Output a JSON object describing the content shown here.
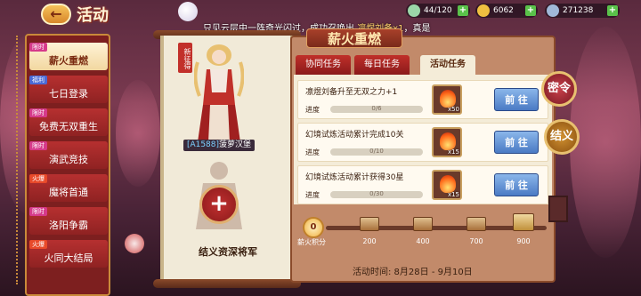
{
  "header": {
    "back_label": "←",
    "title": "活动",
    "marquee_prefix": "只见云层中一阵奇光闪过，成功召唤出 ",
    "marquee_hero": "凛煜刘备x1",
    "marquee_suffix": "，真是"
  },
  "resources": [
    {
      "icon": "jade-icon",
      "value": "44/120",
      "color": "#9bd6a8"
    },
    {
      "icon": "gold-ingot-icon",
      "value": "6062",
      "color": "#f0c040"
    },
    {
      "icon": "silver-coin-icon",
      "value": "271238",
      "color": "#a0b8d8"
    }
  ],
  "sidebar": {
    "items": [
      {
        "tag": "限时",
        "label": "薪火重燃",
        "active": true
      },
      {
        "tag": "福利",
        "label": "七日登录",
        "active": false
      },
      {
        "tag": "限时",
        "label": "免费无双重生",
        "active": false
      },
      {
        "tag": "限时",
        "label": "演武竞技",
        "active": false
      },
      {
        "tag": "火爆",
        "label": "魔将首通",
        "active": false
      },
      {
        "tag": "限时",
        "label": "洛阳争霸",
        "active": false
      },
      {
        "tag": "火爆",
        "label": "火同大结局",
        "active": false
      }
    ]
  },
  "hero": {
    "badge": "新征得",
    "id": "[A1588]",
    "name": "菠萝汉堡"
  },
  "recruit": {
    "button_symbol": "+",
    "label": "结义资深将军"
  },
  "panel": {
    "title": "薪火重燃",
    "tabs": [
      "协同任务",
      "每日任务",
      "活动任务"
    ],
    "active_tab": 2,
    "progress_label": "进度",
    "go_label": "前 往"
  },
  "tasks": [
    {
      "title": "凛煜刘备升至无双之力+1",
      "progress_text": "0/6",
      "progress": 0,
      "reward": "flame-icon",
      "reward_count": "x50"
    },
    {
      "title": "幻境试炼活动累计完成10关",
      "progress_text": "0/10",
      "progress": 0,
      "reward": "flame-icon",
      "reward_count": "x15"
    },
    {
      "title": "幻境试炼活动累计获得30星",
      "progress_text": "0/30",
      "progress": 0,
      "reward": "flame-icon",
      "reward_count": "x15"
    }
  ],
  "milestones": {
    "score": "0",
    "score_label": "薪火积分",
    "values": [
      "200",
      "400",
      "700",
      "900"
    ]
  },
  "event_time": "活动时间:  8月28日 - 9月10日",
  "side_buttons": {
    "secret": "密令",
    "sworn": "结义"
  },
  "colors": {
    "accent_red": "#b63030",
    "gold": "#c98a3a",
    "button_blue": "#4a7ac4"
  }
}
